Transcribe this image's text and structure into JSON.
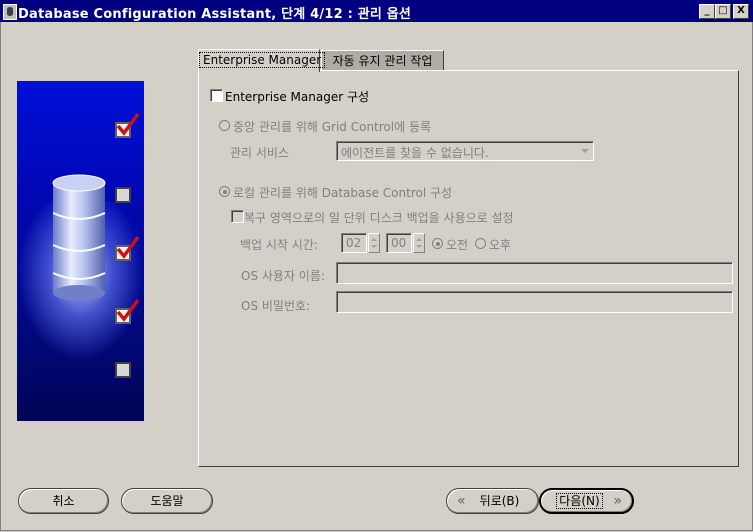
{
  "window": {
    "title": "Database Configuration Assistant, 단계 4/12 : 관리 옵션",
    "controls": [
      "_",
      "□",
      "X"
    ]
  },
  "steps_panel": {
    "step_markers": [
      "checked",
      "unchecked",
      "checked",
      "checked",
      "unchecked"
    ],
    "icon": "database-cylinder"
  },
  "tabs": [
    {
      "label": "Enterprise Manager",
      "active": true
    },
    {
      "label": "자동 유지 관리 작업",
      "active": false
    }
  ],
  "em": {
    "configure_label": "Enterprise Manager 구성",
    "configure_checked": false,
    "grid_radio_label": "중앙 관리를 위해 Grid Control에 등록",
    "management_service_label": "관리 서비스",
    "management_service_value": "에이전트를 찾을 수 없습니다.",
    "db_control_radio_label": "로컬 관리를 위해 Database Control 구성",
    "backup_checkbox_label": "복구 영역으로의 일 단위 디스크 백업을 사용으로 설정",
    "backup_time_label": "백업 시작 시간:",
    "backup_hour": "02",
    "backup_minute": "00",
    "am_label": "오전",
    "pm_label": "오후",
    "os_user_label": "OS 사용자 이름:",
    "os_user_value": "",
    "os_password_label": "OS 비밀번호:",
    "os_password_value": ""
  },
  "footer": {
    "cancel": "취소",
    "help": "도움말",
    "back": "뒤로(B)",
    "next": "다음(N)"
  }
}
